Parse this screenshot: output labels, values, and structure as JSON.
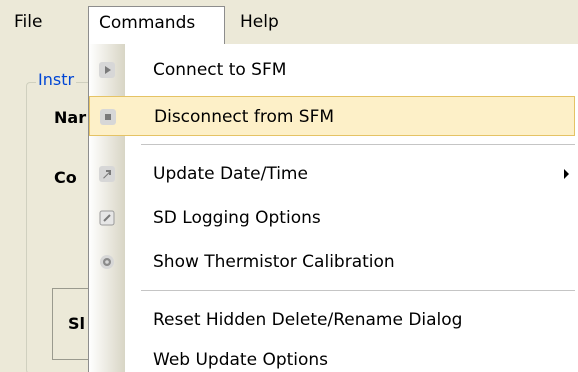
{
  "menubar": {
    "file": "File",
    "commands": "Commands",
    "help": "Help"
  },
  "background": {
    "group_title": "Instr",
    "label_name": "Nar",
    "label_com": "Co",
    "panel_label": "Sl"
  },
  "commands_menu": {
    "items": [
      {
        "label": "Connect to SFM",
        "icon": "play-icon"
      },
      {
        "label": "Disconnect from SFM",
        "icon": "stop-icon",
        "highlighted": true
      },
      {
        "label": "Update Date/Time",
        "icon": "arrow-icon",
        "has_submenu": true
      },
      {
        "label": "SD Logging Options",
        "icon": "edit-icon"
      },
      {
        "label": "Show Thermistor Calibration",
        "icon": "gear-icon"
      },
      {
        "label": "Reset Hidden Delete/Rename Dialog"
      },
      {
        "label": "Web Update Options"
      }
    ]
  },
  "colors": {
    "menu_highlight": "#fdf0c8",
    "menu_highlight_border": "#e5c365",
    "window_background": "#ece9d8",
    "group_title": "#0046d5"
  }
}
